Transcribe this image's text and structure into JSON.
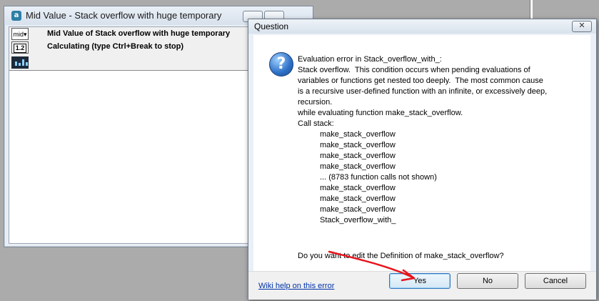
{
  "left_window": {
    "title": "Mid Value - Stack overflow with huge temporary",
    "icon_label": "a",
    "tool_mid_label": "mid▾",
    "tool_table_label": "1.2",
    "header_line1": "Mid Value of Stack overflow with huge temporary",
    "header_line2": "Calculating (type Ctrl+Break to stop)"
  },
  "dialog": {
    "title": "Question",
    "close_glyph": "✕",
    "icon_glyph": "?",
    "message_lines": [
      "Evaluation error in Stack_overflow_with_:",
      "Stack overflow.  This condition occurs when pending evaluations of",
      "variables or functions get nested too deeply.  The most common cause",
      "is a recursive user-defined function with an infinite, or excessively deep,",
      "recursion.",
      "while evaluating function make_stack_overflow.",
      "Call stack:"
    ],
    "call_stack": [
      "make_stack_overflow",
      "make_stack_overflow",
      "make_stack_overflow",
      "make_stack_overflow",
      "... (8783 function calls not shown)",
      "make_stack_overflow",
      "make_stack_overflow",
      "make_stack_overflow",
      "Stack_overflow_with_"
    ],
    "prompt": "Do you want to edit the Definition of make_stack_overflow?",
    "wiki_link": "Wiki help on this error",
    "buttons": {
      "yes": "Yes",
      "no": "No",
      "cancel": "Cancel"
    },
    "default_button": "yes"
  },
  "colors": {
    "arrow": "#e8141c",
    "link": "#0033aa",
    "default_button_border": "#2f76c2"
  }
}
